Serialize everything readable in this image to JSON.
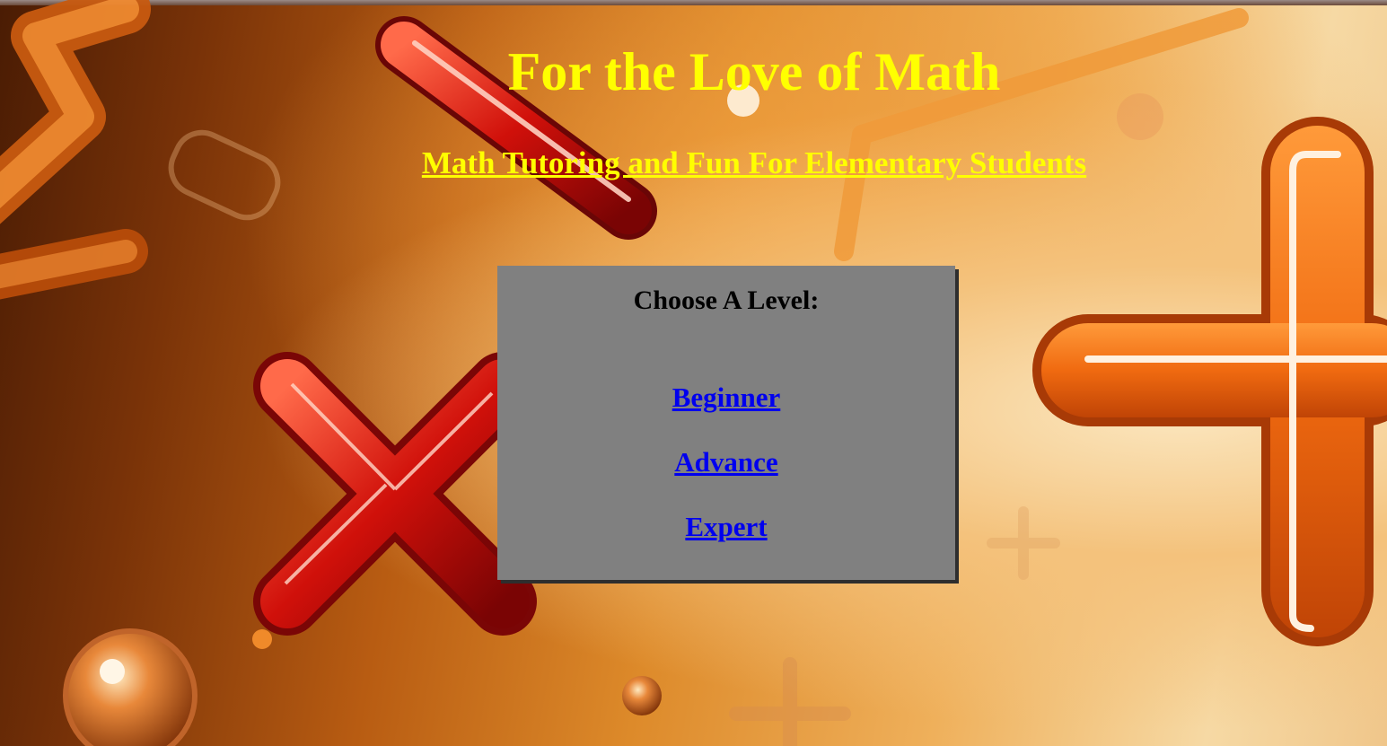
{
  "header": {
    "title": "For the Love of Math",
    "subtitle": "Math Tutoring and Fun For Elementary Students"
  },
  "level_panel": {
    "heading": "Choose A Level:",
    "levels": [
      {
        "label": "Beginner"
      },
      {
        "label": "Advance"
      },
      {
        "label": "Expert"
      }
    ]
  },
  "colors": {
    "title": "#ffff00",
    "panel_background": "#808080",
    "link": "#0000ee"
  },
  "background": {
    "decorations": [
      "times-symbol-icon",
      "plus-symbol-icon",
      "minus-symbol-icon",
      "bracket-symbol-icon",
      "orb-icon"
    ]
  }
}
